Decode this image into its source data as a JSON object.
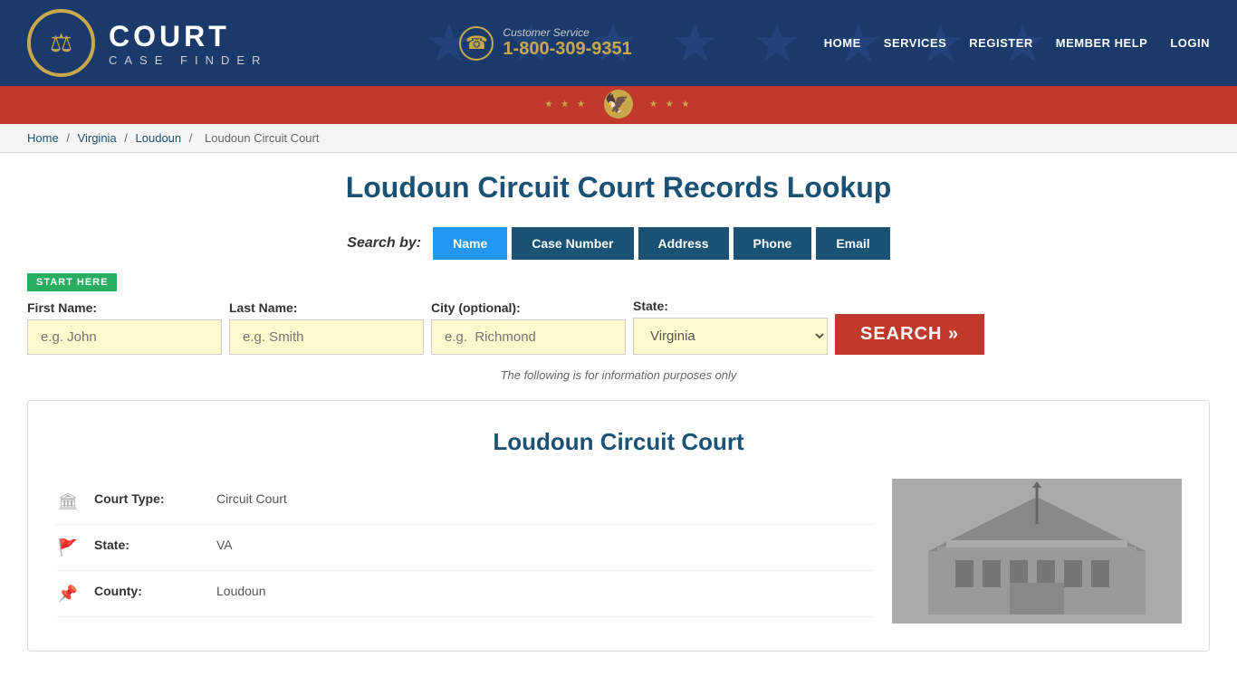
{
  "site": {
    "name": "COURT",
    "tagline": "CASE FINDER",
    "logo_symbol": "⚖"
  },
  "customer_service": {
    "label": "Customer Service",
    "phone": "1-800-309-9351"
  },
  "nav": {
    "items": [
      {
        "label": "HOME",
        "url": "#"
      },
      {
        "label": "SERVICES",
        "url": "#"
      },
      {
        "label": "REGISTER",
        "url": "#"
      },
      {
        "label": "MEMBER HELP",
        "url": "#"
      },
      {
        "label": "LOGIN",
        "url": "#"
      }
    ]
  },
  "breadcrumb": {
    "items": [
      {
        "label": "Home",
        "url": "#"
      },
      {
        "label": "Virginia",
        "url": "#"
      },
      {
        "label": "Loudoun",
        "url": "#"
      },
      {
        "label": "Loudoun Circuit Court",
        "url": null
      }
    ]
  },
  "page": {
    "title": "Loudoun Circuit Court Records Lookup"
  },
  "search": {
    "search_by_label": "Search by:",
    "tabs": [
      {
        "label": "Name",
        "active": true
      },
      {
        "label": "Case Number",
        "active": false
      },
      {
        "label": "Address",
        "active": false
      },
      {
        "label": "Phone",
        "active": false
      },
      {
        "label": "Email",
        "active": false
      }
    ],
    "start_here": "START HERE",
    "fields": {
      "first_name_label": "First Name:",
      "first_name_placeholder": "e.g. John",
      "last_name_label": "Last Name:",
      "last_name_placeholder": "e.g. Smith",
      "city_label": "City (optional):",
      "city_placeholder": "e.g.  Richmond",
      "state_label": "State:",
      "state_value": "Virginia"
    },
    "search_button": "SEARCH »",
    "info_notice": "The following is for information purposes only"
  },
  "court": {
    "title": "Loudoun Circuit Court",
    "details": [
      {
        "icon": "🏛",
        "label": "Court Type:",
        "value": "Circuit Court"
      },
      {
        "icon": "🚩",
        "label": "State:",
        "value": "VA"
      },
      {
        "icon": "📌",
        "label": "County:",
        "value": "Loudoun"
      }
    ]
  }
}
